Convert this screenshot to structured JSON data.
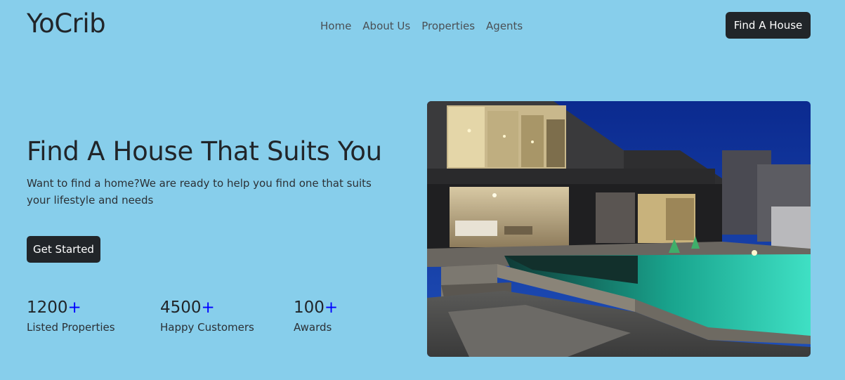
{
  "header": {
    "brand": "YoCrib",
    "nav": [
      {
        "label": "Home"
      },
      {
        "label": "About Us"
      },
      {
        "label": "Properties"
      },
      {
        "label": "Agents"
      }
    ],
    "cta": "Find A House"
  },
  "hero": {
    "title": "Find A House That Suits You",
    "subtitle": "Want to find a home?We are ready to help you find one that suits your lifestyle and needs",
    "cta": "Get Started",
    "image": "modern-house-with-pool-at-night"
  },
  "stats": [
    {
      "value": "1200",
      "suffix": "+",
      "label": "Listed Properties"
    },
    {
      "value": "4500",
      "suffix": "+",
      "label": "Happy Customers"
    },
    {
      "value": "100",
      "suffix": "+",
      "label": "Awards"
    }
  ],
  "colors": {
    "background": "#87ceeb",
    "button": "#212529",
    "accent": "#0000ff"
  }
}
